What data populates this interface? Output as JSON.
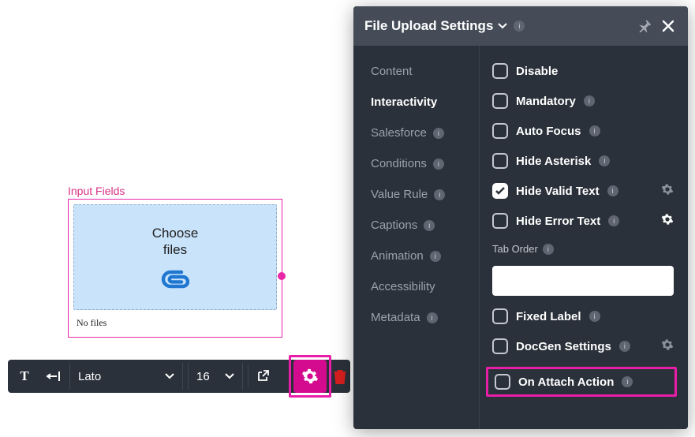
{
  "canvas": {
    "group_label": "Input Fields",
    "widget_text_line1": "Choose",
    "widget_text_line2": "files",
    "footer_text": "No files"
  },
  "toolbar": {
    "font_name": "Lato",
    "font_size": "16"
  },
  "panel": {
    "title": "File Upload Settings",
    "nav": {
      "content": "Content",
      "interactivity": "Interactivity",
      "salesforce": "Salesforce",
      "conditions": "Conditions",
      "value_rule": "Value Rule",
      "captions": "Captions",
      "animation": "Animation",
      "accessibility": "Accessibility",
      "metadata": "Metadata"
    },
    "options": {
      "disable": "Disable",
      "mandatory": "Mandatory",
      "auto_focus": "Auto Focus",
      "hide_asterisk": "Hide Asterisk",
      "hide_valid_text": "Hide Valid Text",
      "hide_error_text": "Hide Error Text",
      "tab_order": "Tab Order",
      "tab_order_value": "",
      "fixed_label": "Fixed Label",
      "docgen_settings": "DocGen Settings",
      "on_attach_action": "On Attach Action"
    }
  }
}
